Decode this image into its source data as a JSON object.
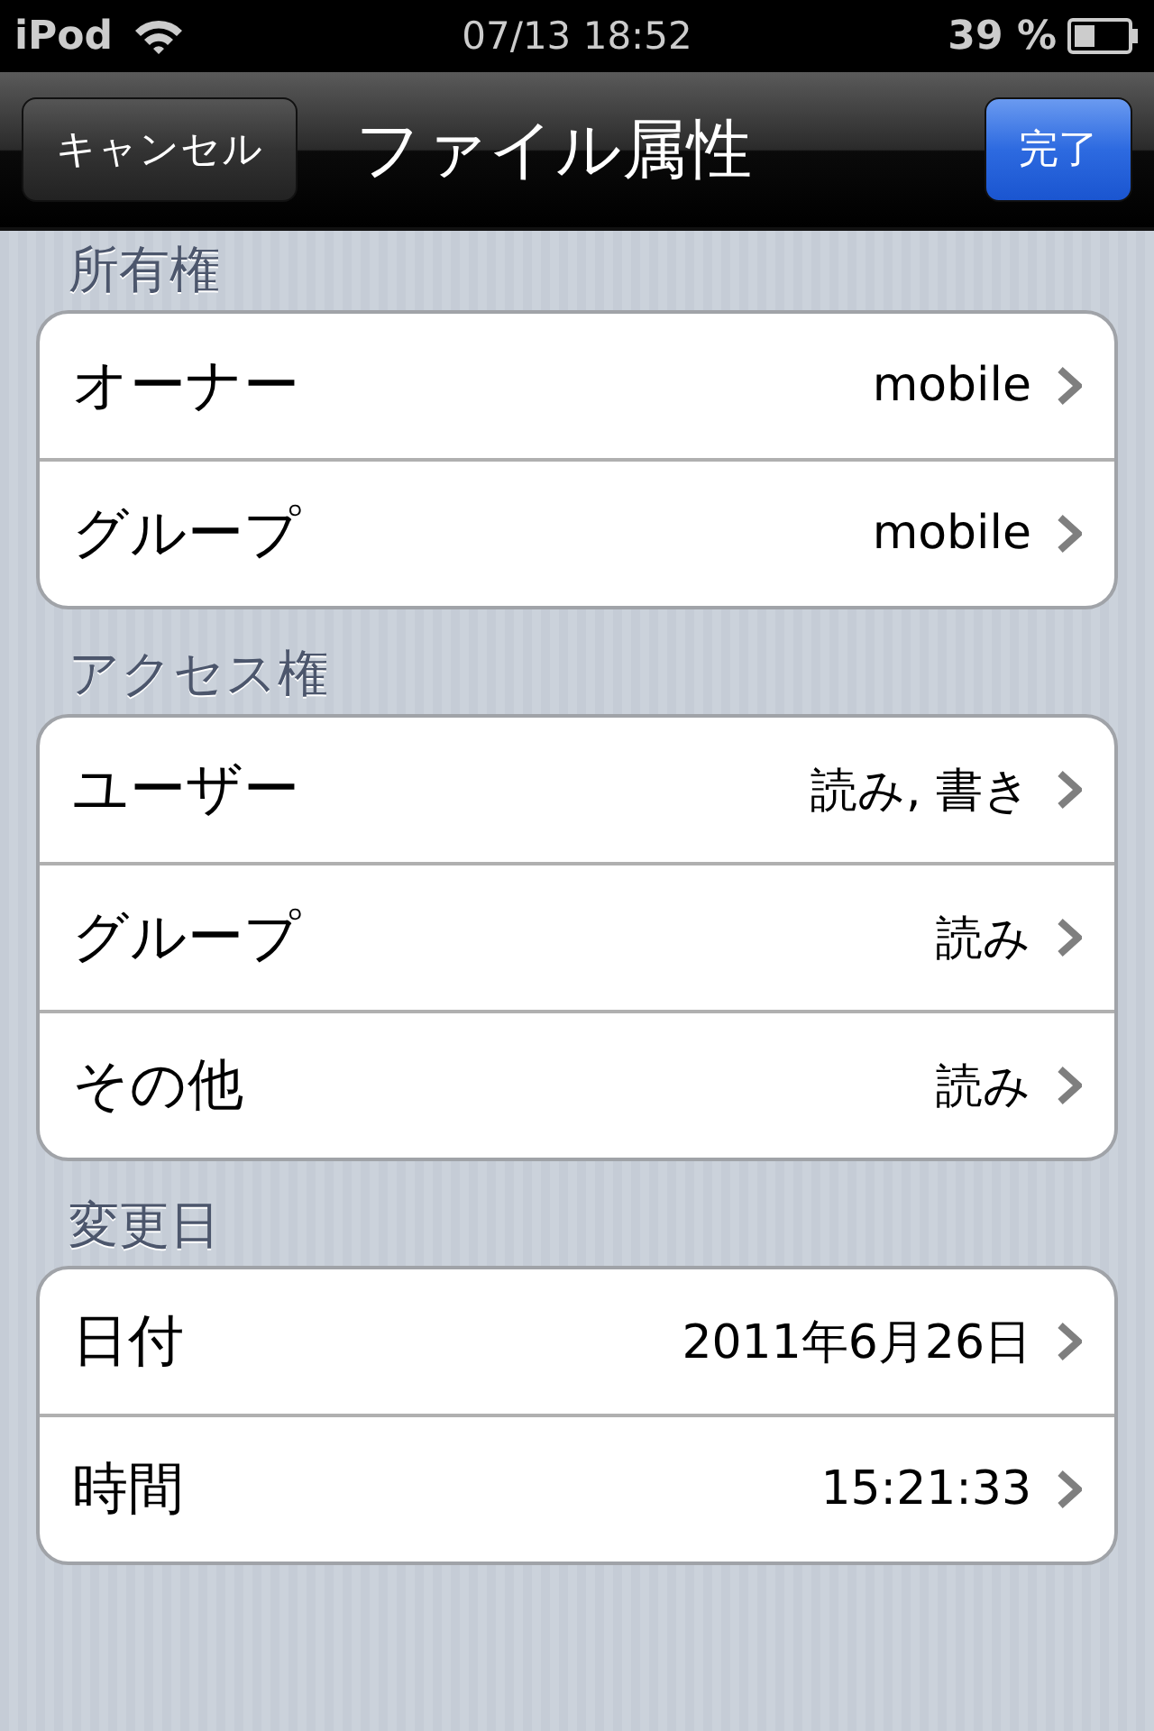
{
  "status_bar": {
    "carrier": "iPod",
    "time": "07/13 18:52",
    "battery": "39 %"
  },
  "nav_bar": {
    "cancel": "キャンセル",
    "title": "ファイル属性",
    "done": "完了"
  },
  "sections": [
    {
      "header": "所有権",
      "rows": [
        {
          "label": "オーナー",
          "value": "mobile"
        },
        {
          "label": "グループ",
          "value": "mobile"
        }
      ]
    },
    {
      "header": "アクセス権",
      "rows": [
        {
          "label": "ユーザー",
          "value": "読み, 書き"
        },
        {
          "label": "グループ",
          "value": "読み"
        },
        {
          "label": "その他",
          "value": "読み"
        }
      ]
    },
    {
      "header": "変更日",
      "rows": [
        {
          "label": "日付",
          "value": "2011年6月26日"
        },
        {
          "label": "時間",
          "value": "15:21:33"
        }
      ]
    }
  ]
}
